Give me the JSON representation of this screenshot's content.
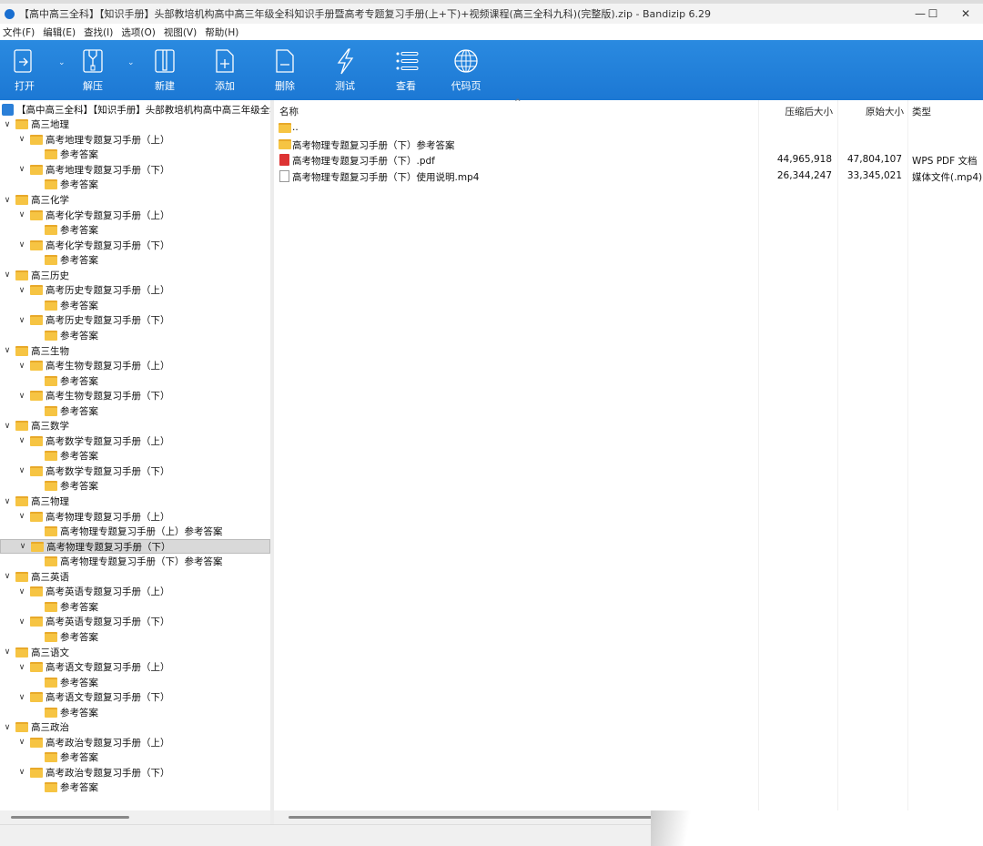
{
  "title": "【高中高三全科】【知识手册】头部教培机构高中高三年级全科知识手册暨高考专题复习手册(上+下)+视频课程(高三全科九科)(完整版).zip - Bandizip 6.29",
  "window_controls": {
    "minimize": "—",
    "maximize": "☐",
    "close": "✕"
  },
  "menu": [
    "文件(F)",
    "编辑(E)",
    "查找(I)",
    "选项(O)",
    "视图(V)",
    "帮助(H)"
  ],
  "toolbar": [
    {
      "label": "打开",
      "icon": "open-icon"
    },
    {
      "label": "解压",
      "icon": "extract-icon"
    },
    {
      "label": "新建",
      "icon": "new-archive-icon"
    },
    {
      "label": "添加",
      "icon": "add-file-icon"
    },
    {
      "label": "删除",
      "icon": "delete-file-icon"
    },
    {
      "label": "测试",
      "icon": "test-icon"
    },
    {
      "label": "查看",
      "icon": "view-list-icon"
    },
    {
      "label": "代码页",
      "icon": "codepage-globe-icon"
    }
  ],
  "tree_root": "【高中高三全科】【知识手册】头部教培机构高中高三年级全科知识手册暨高考专题复习手册",
  "tree": [
    {
      "l": 0,
      "t": "高三地理"
    },
    {
      "l": 1,
      "t": "高考地理专题复习手册（上）"
    },
    {
      "l": 2,
      "t": "参考答案"
    },
    {
      "l": 1,
      "t": "高考地理专题复习手册（下）"
    },
    {
      "l": 2,
      "t": "参考答案"
    },
    {
      "l": 0,
      "t": "高三化学"
    },
    {
      "l": 1,
      "t": "高考化学专题复习手册（上）"
    },
    {
      "l": 2,
      "t": "参考答案"
    },
    {
      "l": 1,
      "t": "高考化学专题复习手册（下）"
    },
    {
      "l": 2,
      "t": "参考答案"
    },
    {
      "l": 0,
      "t": "高三历史"
    },
    {
      "l": 1,
      "t": "高考历史专题复习手册（上）"
    },
    {
      "l": 2,
      "t": "参考答案"
    },
    {
      "l": 1,
      "t": "高考历史专题复习手册（下）"
    },
    {
      "l": 2,
      "t": "参考答案"
    },
    {
      "l": 0,
      "t": "高三生物"
    },
    {
      "l": 1,
      "t": "高考生物专题复习手册（上）"
    },
    {
      "l": 2,
      "t": "参考答案"
    },
    {
      "l": 1,
      "t": "高考生物专题复习手册（下）"
    },
    {
      "l": 2,
      "t": "参考答案"
    },
    {
      "l": 0,
      "t": "高三数学"
    },
    {
      "l": 1,
      "t": "高考数学专题复习手册（上）"
    },
    {
      "l": 2,
      "t": "参考答案"
    },
    {
      "l": 1,
      "t": "高考数学专题复习手册（下）"
    },
    {
      "l": 2,
      "t": "参考答案"
    },
    {
      "l": 0,
      "t": "高三物理"
    },
    {
      "l": 1,
      "t": "高考物理专题复习手册（上）"
    },
    {
      "l": 2,
      "t": "高考物理专题复习手册（上）参考答案"
    },
    {
      "l": 1,
      "t": "高考物理专题复习手册（下）",
      "sel": true
    },
    {
      "l": 2,
      "t": "高考物理专题复习手册（下）参考答案"
    },
    {
      "l": 0,
      "t": "高三英语"
    },
    {
      "l": 1,
      "t": "高考英语专题复习手册（上）"
    },
    {
      "l": 2,
      "t": "参考答案"
    },
    {
      "l": 1,
      "t": "高考英语专题复习手册（下）"
    },
    {
      "l": 2,
      "t": "参考答案"
    },
    {
      "l": 0,
      "t": "高三语文"
    },
    {
      "l": 1,
      "t": "高考语文专题复习手册（上）"
    },
    {
      "l": 2,
      "t": "参考答案"
    },
    {
      "l": 1,
      "t": "高考语文专题复习手册（下）"
    },
    {
      "l": 2,
      "t": "参考答案"
    },
    {
      "l": 0,
      "t": "高三政治"
    },
    {
      "l": 1,
      "t": "高考政治专题复习手册（上）"
    },
    {
      "l": 2,
      "t": "参考答案"
    },
    {
      "l": 1,
      "t": "高考政治专题复习手册（下）"
    },
    {
      "l": 2,
      "t": "参考答案"
    }
  ],
  "columns": {
    "name": "名称",
    "compressed": "压缩后大小",
    "original": "原始大小",
    "type": "类型"
  },
  "files": [
    {
      "name": "..",
      "icon": "folder",
      "compressed": "",
      "original": "",
      "type": ""
    },
    {
      "name": "高考物理专题复习手册（下）参考答案",
      "icon": "folder",
      "compressed": "",
      "original": "",
      "type": ""
    },
    {
      "name": "高考物理专题复习手册（下）.pdf",
      "icon": "pdf",
      "compressed": "44,965,918",
      "original": "47,804,107",
      "type": "WPS PDF 文档"
    },
    {
      "name": "高考物理专题复习手册（下）使用说明.mp4",
      "icon": "file",
      "compressed": "26,344,247",
      "original": "33,345,021",
      "type": "媒体文件(.mp4)"
    }
  ]
}
